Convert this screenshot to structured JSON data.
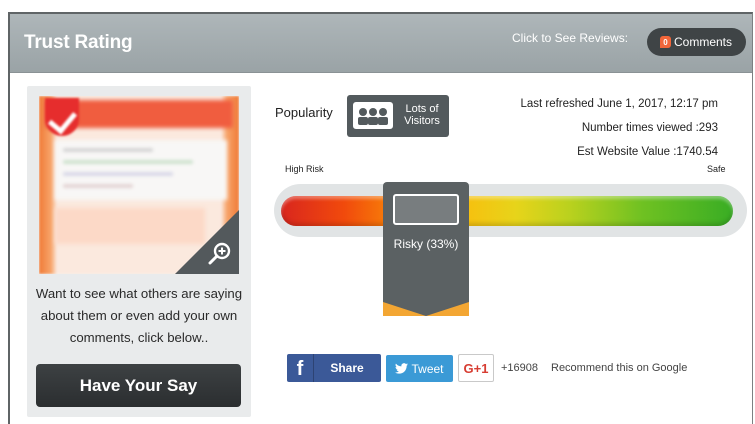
{
  "header": {
    "title": "Trust Rating",
    "see_reviews": "Click to See Reviews:",
    "comments_count": "0",
    "comments_label": "Comments"
  },
  "left_panel": {
    "prompt_text": "Want to see what others are saying about them or even add your own comments, click below..",
    "button_label": "Have Your Say"
  },
  "popularity": {
    "label": "Popularity",
    "badge_label": "Lots of Visitors"
  },
  "meta": {
    "last_refreshed": "Last refreshed June 1, 2017, 12:17 pm",
    "times_viewed": "Number times viewed :293",
    "website_value": "Est Website Value :1740.54"
  },
  "risk_meter": {
    "low_label": "High Risk",
    "high_label": "Safe",
    "result_label": "Risky (33%)",
    "score_fraction": 0.33,
    "colors": {
      "red": "#d9261e",
      "orange": "#fb9b07",
      "yellow": "#e7d41a",
      "green": "#39ad24"
    }
  },
  "social": {
    "facebook_icon": "f",
    "facebook_label": "Share",
    "twitter_label": "Tweet",
    "gplus_label": "G+1",
    "gplus_count": "+16908",
    "gplus_recommend": "Recommend this on Google"
  }
}
